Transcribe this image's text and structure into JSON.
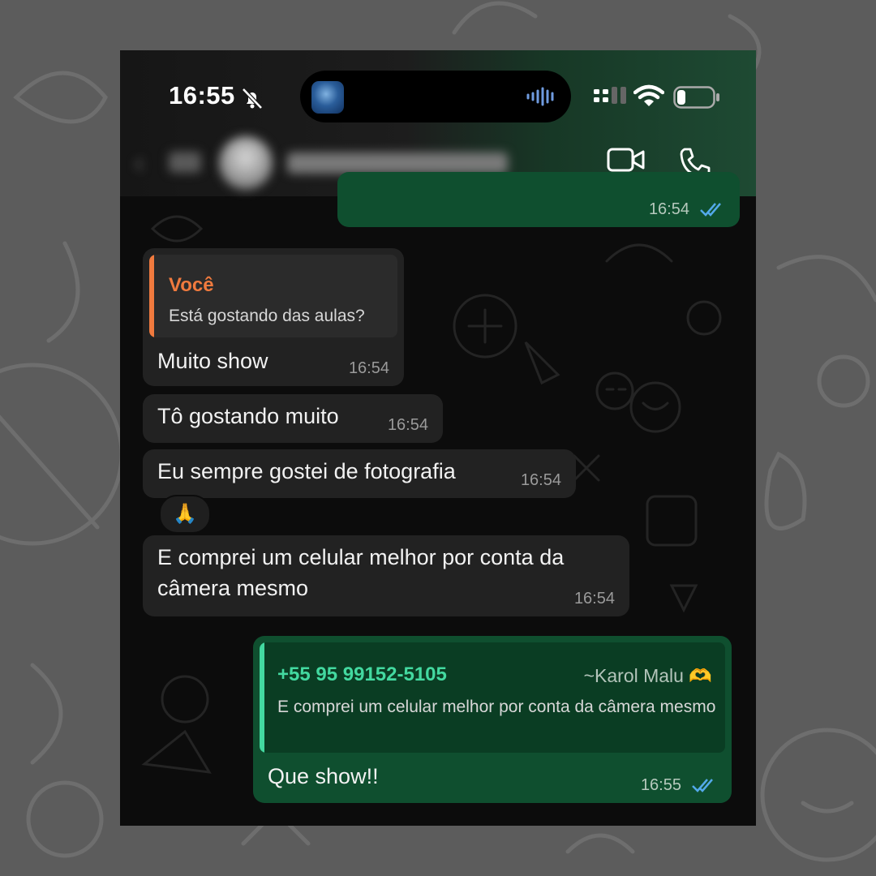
{
  "status_bar": {
    "time": "16:55",
    "bell_icon": "bell-slash-icon",
    "wifi_icon": "wifi-icon",
    "battery_icon": "battery-low-icon"
  },
  "header": {
    "video_icon": "video-camera-icon",
    "call_icon": "phone-icon"
  },
  "messages": [
    {
      "direction": "out",
      "time": "16:54"
    },
    {
      "direction": "in",
      "quote": {
        "sender": "Você",
        "text": "Está gostando das aulas?"
      },
      "text": "Muito show",
      "time": "16:54"
    },
    {
      "direction": "in",
      "text": "Tô gostando muito",
      "time": "16:54"
    },
    {
      "direction": "in",
      "text": "Eu sempre gostei de fotografia",
      "time": "16:54",
      "reaction": "🙏"
    },
    {
      "direction": "in",
      "text_line1": "E comprei um celular melhor por conta da",
      "text_line2": "câmera mesmo",
      "time": "16:54"
    },
    {
      "direction": "out",
      "quote": {
        "sender": "+55 95 99152-5105",
        "author": "~Karol Malu 🫶",
        "text": "E comprei um celular melhor por conta da câmera mesmo"
      },
      "text": "Que show!!",
      "time": "16:55"
    }
  ],
  "colors": {
    "incoming_bubble": "#222222",
    "outgoing_bubble": "#0f4f2f",
    "quote_you": "#f07a3e",
    "quote_contact": "#43d9a0",
    "read_check": "#53a9ea"
  }
}
